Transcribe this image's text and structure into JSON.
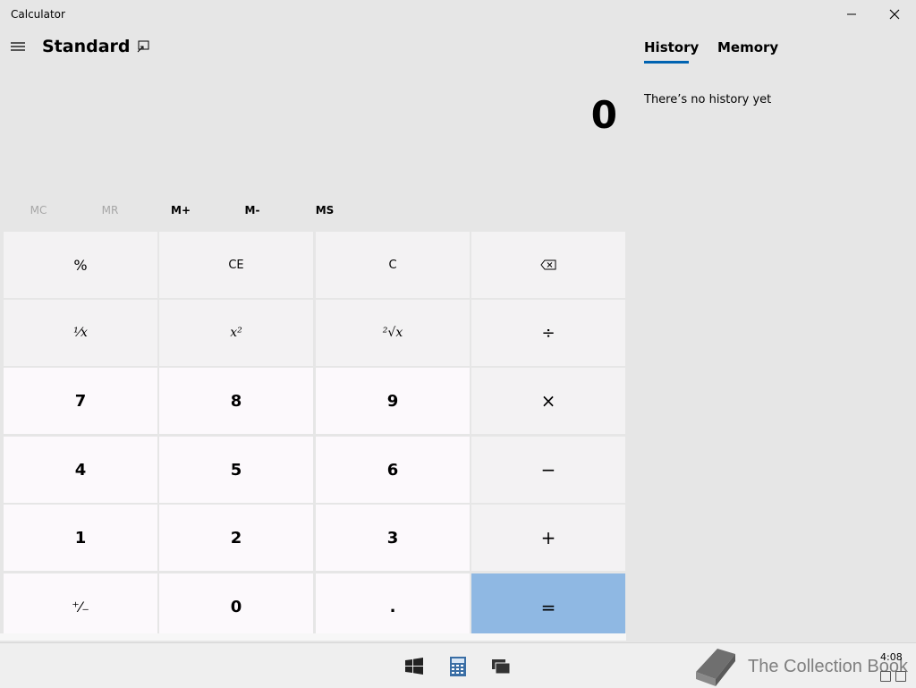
{
  "app": {
    "title": "Calculator"
  },
  "header": {
    "mode": "Standard"
  },
  "display": {
    "value": "0"
  },
  "memory": [
    "MC",
    "MR",
    "M+",
    "M-",
    "MS"
  ],
  "keys": {
    "percent": "%",
    "ce": "CE",
    "c": "C",
    "backspace_icon": "backspace-icon",
    "reciprocal": "¹⁄x",
    "square": "x²",
    "sqrt": "²√x",
    "divide": "÷",
    "seven": "7",
    "eight": "8",
    "nine": "9",
    "multiply": "×",
    "four": "4",
    "five": "5",
    "six": "6",
    "subtract": "−",
    "one": "1",
    "two": "2",
    "three": "3",
    "add": "+",
    "negate": "⁺⁄₋",
    "zero": "0",
    "decimal": ".",
    "equals": "="
  },
  "panel": {
    "tab_history": "History",
    "tab_memory": "Memory",
    "empty_message": "There’s no history yet"
  },
  "taskbar": {
    "watermark": "The Collection Book",
    "time": "4:08"
  },
  "colors": {
    "accent": "#0063b1",
    "equals_key": "#8fb8e3",
    "background": "#e6e6e6"
  }
}
